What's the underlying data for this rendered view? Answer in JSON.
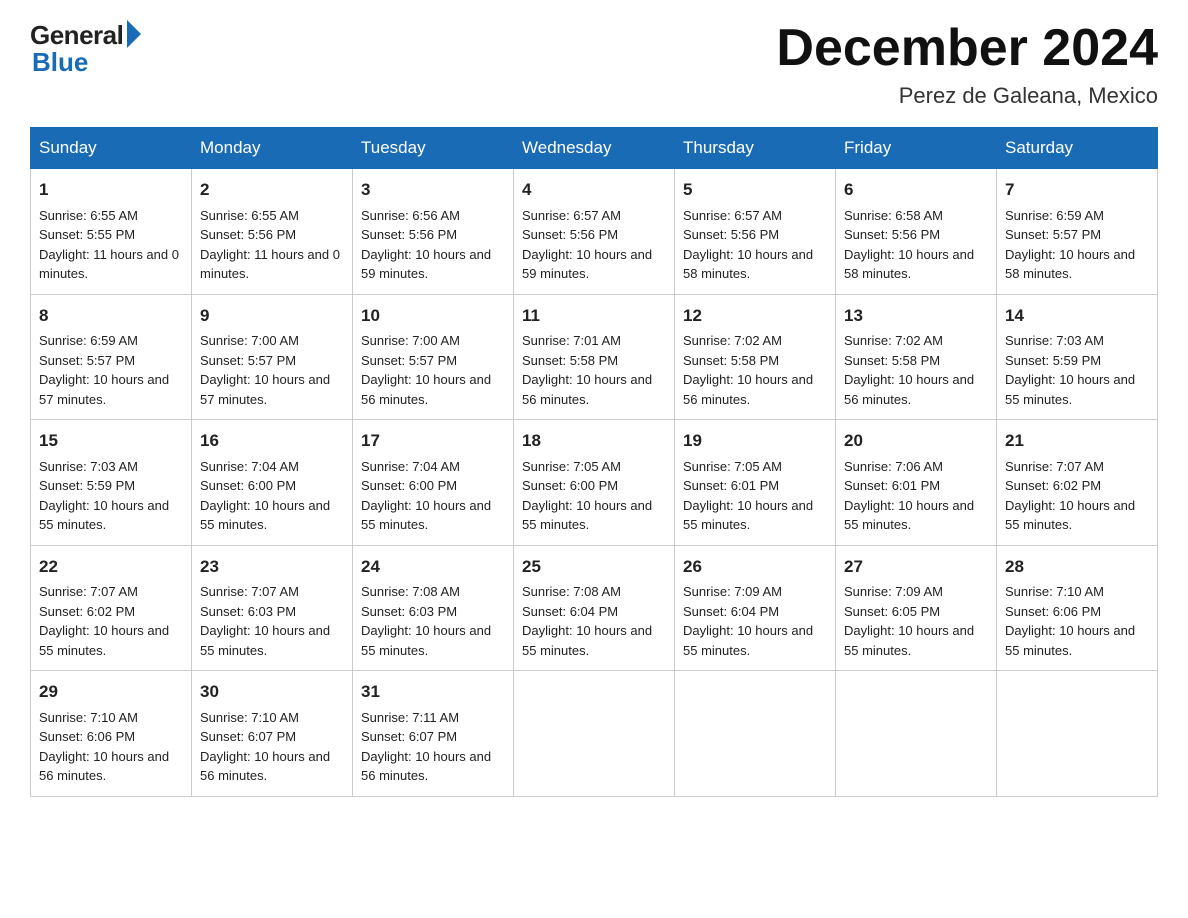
{
  "header": {
    "logo_general": "General",
    "logo_blue": "Blue",
    "month_title": "December 2024",
    "location": "Perez de Galeana, Mexico"
  },
  "weekdays": [
    "Sunday",
    "Monday",
    "Tuesday",
    "Wednesday",
    "Thursday",
    "Friday",
    "Saturday"
  ],
  "weeks": [
    [
      {
        "day": "1",
        "sunrise": "6:55 AM",
        "sunset": "5:55 PM",
        "daylight": "11 hours and 0 minutes."
      },
      {
        "day": "2",
        "sunrise": "6:55 AM",
        "sunset": "5:56 PM",
        "daylight": "11 hours and 0 minutes."
      },
      {
        "day": "3",
        "sunrise": "6:56 AM",
        "sunset": "5:56 PM",
        "daylight": "10 hours and 59 minutes."
      },
      {
        "day": "4",
        "sunrise": "6:57 AM",
        "sunset": "5:56 PM",
        "daylight": "10 hours and 59 minutes."
      },
      {
        "day": "5",
        "sunrise": "6:57 AM",
        "sunset": "5:56 PM",
        "daylight": "10 hours and 58 minutes."
      },
      {
        "day": "6",
        "sunrise": "6:58 AM",
        "sunset": "5:56 PM",
        "daylight": "10 hours and 58 minutes."
      },
      {
        "day": "7",
        "sunrise": "6:59 AM",
        "sunset": "5:57 PM",
        "daylight": "10 hours and 58 minutes."
      }
    ],
    [
      {
        "day": "8",
        "sunrise": "6:59 AM",
        "sunset": "5:57 PM",
        "daylight": "10 hours and 57 minutes."
      },
      {
        "day": "9",
        "sunrise": "7:00 AM",
        "sunset": "5:57 PM",
        "daylight": "10 hours and 57 minutes."
      },
      {
        "day": "10",
        "sunrise": "7:00 AM",
        "sunset": "5:57 PM",
        "daylight": "10 hours and 56 minutes."
      },
      {
        "day": "11",
        "sunrise": "7:01 AM",
        "sunset": "5:58 PM",
        "daylight": "10 hours and 56 minutes."
      },
      {
        "day": "12",
        "sunrise": "7:02 AM",
        "sunset": "5:58 PM",
        "daylight": "10 hours and 56 minutes."
      },
      {
        "day": "13",
        "sunrise": "7:02 AM",
        "sunset": "5:58 PM",
        "daylight": "10 hours and 56 minutes."
      },
      {
        "day": "14",
        "sunrise": "7:03 AM",
        "sunset": "5:59 PM",
        "daylight": "10 hours and 55 minutes."
      }
    ],
    [
      {
        "day": "15",
        "sunrise": "7:03 AM",
        "sunset": "5:59 PM",
        "daylight": "10 hours and 55 minutes."
      },
      {
        "day": "16",
        "sunrise": "7:04 AM",
        "sunset": "6:00 PM",
        "daylight": "10 hours and 55 minutes."
      },
      {
        "day": "17",
        "sunrise": "7:04 AM",
        "sunset": "6:00 PM",
        "daylight": "10 hours and 55 minutes."
      },
      {
        "day": "18",
        "sunrise": "7:05 AM",
        "sunset": "6:00 PM",
        "daylight": "10 hours and 55 minutes."
      },
      {
        "day": "19",
        "sunrise": "7:05 AM",
        "sunset": "6:01 PM",
        "daylight": "10 hours and 55 minutes."
      },
      {
        "day": "20",
        "sunrise": "7:06 AM",
        "sunset": "6:01 PM",
        "daylight": "10 hours and 55 minutes."
      },
      {
        "day": "21",
        "sunrise": "7:07 AM",
        "sunset": "6:02 PM",
        "daylight": "10 hours and 55 minutes."
      }
    ],
    [
      {
        "day": "22",
        "sunrise": "7:07 AM",
        "sunset": "6:02 PM",
        "daylight": "10 hours and 55 minutes."
      },
      {
        "day": "23",
        "sunrise": "7:07 AM",
        "sunset": "6:03 PM",
        "daylight": "10 hours and 55 minutes."
      },
      {
        "day": "24",
        "sunrise": "7:08 AM",
        "sunset": "6:03 PM",
        "daylight": "10 hours and 55 minutes."
      },
      {
        "day": "25",
        "sunrise": "7:08 AM",
        "sunset": "6:04 PM",
        "daylight": "10 hours and 55 minutes."
      },
      {
        "day": "26",
        "sunrise": "7:09 AM",
        "sunset": "6:04 PM",
        "daylight": "10 hours and 55 minutes."
      },
      {
        "day": "27",
        "sunrise": "7:09 AM",
        "sunset": "6:05 PM",
        "daylight": "10 hours and 55 minutes."
      },
      {
        "day": "28",
        "sunrise": "7:10 AM",
        "sunset": "6:06 PM",
        "daylight": "10 hours and 55 minutes."
      }
    ],
    [
      {
        "day": "29",
        "sunrise": "7:10 AM",
        "sunset": "6:06 PM",
        "daylight": "10 hours and 56 minutes."
      },
      {
        "day": "30",
        "sunrise": "7:10 AM",
        "sunset": "6:07 PM",
        "daylight": "10 hours and 56 minutes."
      },
      {
        "day": "31",
        "sunrise": "7:11 AM",
        "sunset": "6:07 PM",
        "daylight": "10 hours and 56 minutes."
      },
      null,
      null,
      null,
      null
    ]
  ]
}
